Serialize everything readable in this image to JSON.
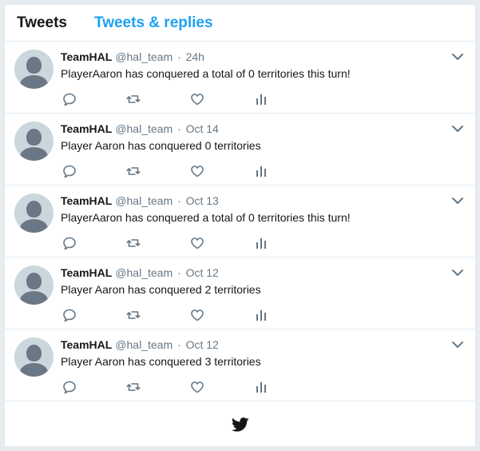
{
  "tabs": [
    {
      "label": "Tweets"
    },
    {
      "label": "Tweets & replies"
    }
  ],
  "tweets": [
    {
      "name": "TeamHAL",
      "handle": "@hal_team",
      "separator": "·",
      "time": "24h",
      "text": "PlayerAaron has conquered a total of 0 territories this turn!"
    },
    {
      "name": "TeamHAL",
      "handle": "@hal_team",
      "separator": "·",
      "time": "Oct 14",
      "text": "Player Aaron has conquered 0 territories"
    },
    {
      "name": "TeamHAL",
      "handle": "@hal_team",
      "separator": "·",
      "time": "Oct 13",
      "text": "PlayerAaron has conquered a total of 0 territories this turn!"
    },
    {
      "name": "TeamHAL",
      "handle": "@hal_team",
      "separator": "·",
      "time": "Oct 12",
      "text": "Player Aaron has conquered 2 territories"
    },
    {
      "name": "TeamHAL",
      "handle": "@hal_team",
      "separator": "·",
      "time": "Oct 12",
      "text": "Player Aaron has conquered 3 territories"
    }
  ],
  "icons": {
    "reply": "reply-icon",
    "retweet": "retweet-icon",
    "like": "heart-icon",
    "stats": "analytics-icon",
    "caret": "chevron-down-icon",
    "footer": "twitter-bird-icon"
  },
  "colors": {
    "accent": "#1da1f2",
    "icon": "#657786",
    "text": "#14171a",
    "avatar_bg": "#ccd6dd"
  }
}
